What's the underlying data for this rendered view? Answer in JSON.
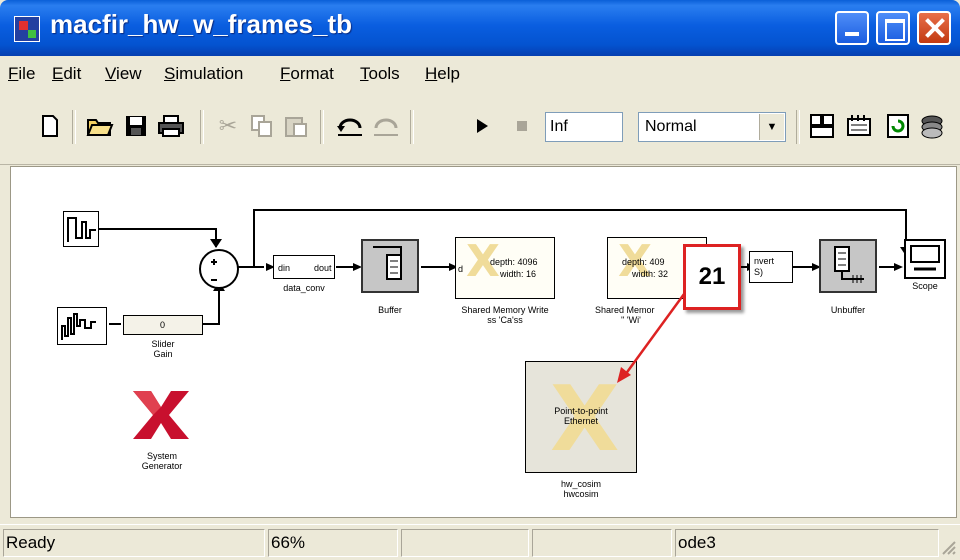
{
  "window": {
    "title": "macfir_hw_w_frames_tb"
  },
  "menu": {
    "items": [
      "File",
      "Edit",
      "View",
      "Simulation",
      "Format",
      "Tools",
      "Help"
    ]
  },
  "toolbar": {
    "stop_time": "Inf",
    "sim_mode": "Normal",
    "icons": [
      "new-icon",
      "open-icon",
      "save-icon",
      "print-icon",
      "cut-icon",
      "copy-icon",
      "paste-icon",
      "undo-icon",
      "redo-icon",
      "start-icon",
      "stop-icon",
      "library-icon",
      "model-explorer-icon",
      "refresh-icon",
      "debug-icon"
    ]
  },
  "model": {
    "blocks": {
      "slider_gain": {
        "value": "0",
        "label": "Slider\nGain"
      },
      "data_conv": {
        "in": "din",
        "out": "dout",
        "label": "data_conv"
      },
      "buffer": {
        "label": "Buffer"
      },
      "shared_write": {
        "line1": "depth: 4096",
        "line2": "width: 16",
        "label": "Shared Memory Write",
        "sublabel": "ss 'Ca'ss"
      },
      "shared_read": {
        "line1": "depth: 409",
        "line2": "width: 32",
        "label": "Shared Memor",
        "sublabel": "'' 'Wi'"
      },
      "convert": {
        "line1": "nvert",
        "line2": "S)"
      },
      "unbuffer": {
        "label": "Unbuffer"
      },
      "scope": {
        "label": "Scope"
      },
      "hwcosim": {
        "text": "Point-to-point\nEthernet",
        "label1": "hw_cosim",
        "label2": "hwcosim"
      },
      "sysgen": {
        "label": "System\nGenerator"
      }
    },
    "callout": {
      "number": "21"
    }
  },
  "status": {
    "state": "Ready",
    "zoom": "66%",
    "solver": "ode3"
  },
  "colors": {
    "callout_border": "#dd2222",
    "xilinx_red": "#c8102e",
    "titlebar": "#0a5ee0"
  }
}
